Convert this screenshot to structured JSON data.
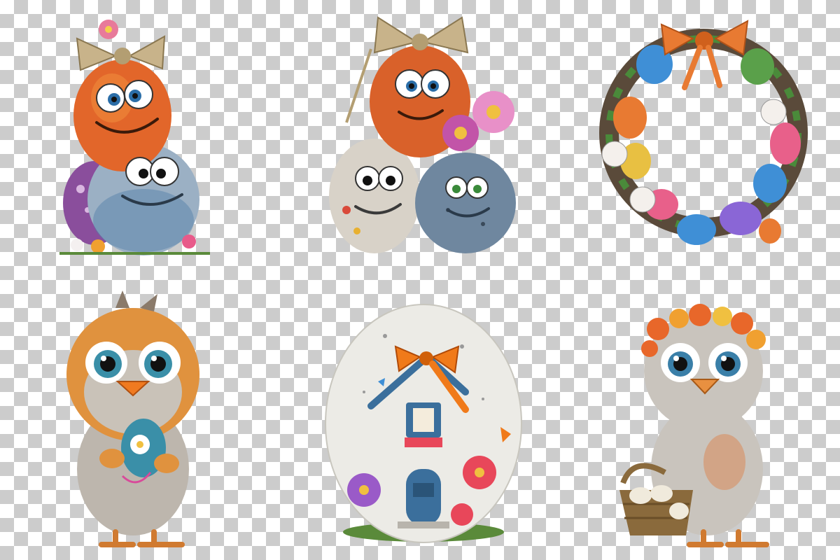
{
  "canvas": {
    "background": "transparency-checkerboard",
    "checker_colors": [
      "#ffffff",
      "#cccccc"
    ]
  },
  "items": [
    {
      "id": "smiling-eggs-with-bow",
      "icon": "egg-trio-icon",
      "colors": [
        "#e2662a",
        "#9bb0c4",
        "#8a4e9c",
        "#c8b38a"
      ]
    },
    {
      "id": "egg-trio-with-flowers",
      "icon": "egg-trio-icon",
      "colors": [
        "#d9612a",
        "#d8d2c8",
        "#6f879f",
        "#c254a8"
      ]
    },
    {
      "id": "easter-egg-wreath",
      "icon": "wreath-icon",
      "colors": [
        "#e87a32",
        "#3f8fd6",
        "#e8c042",
        "#e8608a",
        "#8a66d6",
        "#5aa04a"
      ]
    },
    {
      "id": "fluffy-orange-chick-holding-egg",
      "icon": "chick-icon",
      "colors": [
        "#e0923e",
        "#bdb6ad",
        "#3a8fa8",
        "#f07a20"
      ]
    },
    {
      "id": "egg-fairy-house",
      "icon": "egg-house-icon",
      "colors": [
        "#ecebe6",
        "#f07a1a",
        "#3b6f9c",
        "#e8475a"
      ]
    },
    {
      "id": "gray-chick-with-flower-crown",
      "icon": "chick-icon",
      "colors": [
        "#c9c4bd",
        "#e8672a",
        "#8a6a3c",
        "#f0eadc"
      ]
    }
  ]
}
